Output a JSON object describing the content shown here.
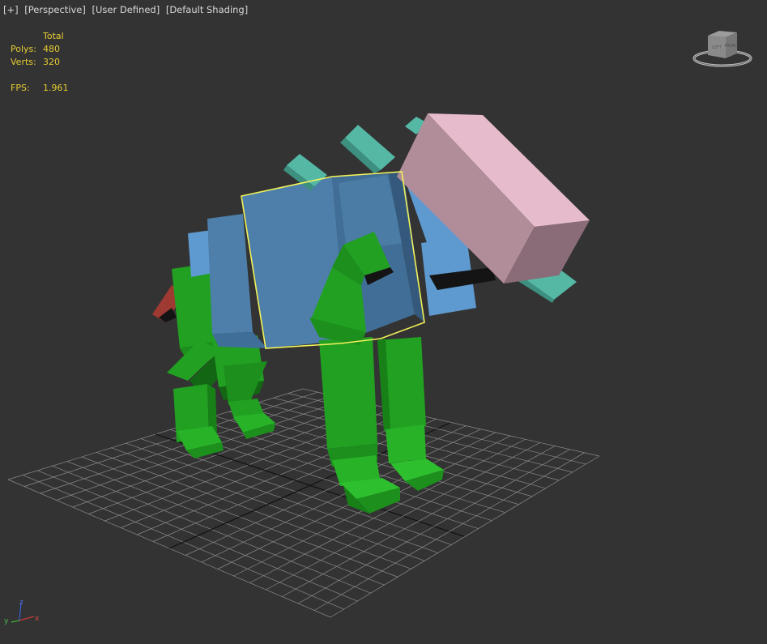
{
  "viewport": {
    "menu": {
      "plus": "[+]",
      "view": "[Perspective]",
      "camera": "[User Defined]",
      "shading": "[Default Shading]"
    },
    "stats": {
      "header": "Total",
      "polys_label": "Polys:",
      "polys_value": "480",
      "verts_label": "Verts:",
      "verts_value": "320",
      "fps_label": "FPS:",
      "fps_value": "1.961"
    },
    "viewcube": {
      "left_face": "LEFT",
      "front_face": "FRONT"
    },
    "axis": {
      "z": "z",
      "y": "y",
      "x": "x"
    }
  },
  "colors": {
    "background": "#333333",
    "grid": "#8a8a8a",
    "grid_axis": "#111111",
    "body": "#4d7faa",
    "legs": "#22a022",
    "head": "#d9a8b8",
    "tusks": "#55b8a5",
    "tail": "#9e3a32",
    "selection": "#f2f25a",
    "stats_text": "#e6cc33"
  }
}
